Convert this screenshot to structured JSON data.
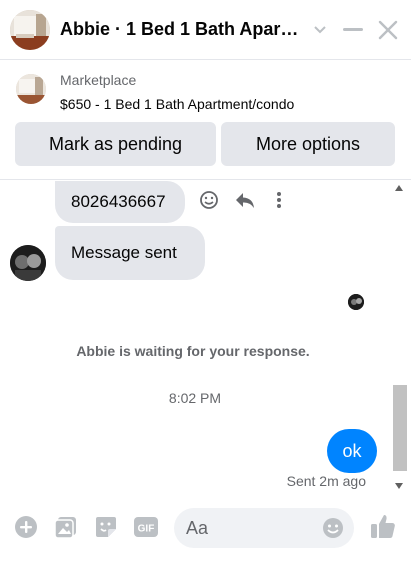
{
  "header": {
    "title": "Abbie · 1 Bed 1 Bath Apartment/condo",
    "icons": [
      "chevron-down-icon",
      "minimize-icon",
      "close-icon"
    ]
  },
  "listing": {
    "source": "Marketplace",
    "title": "$650 - 1 Bed 1 Bath Apartment/condo",
    "mark_pending_label": "Mark as pending",
    "more_options_label": "More options"
  },
  "messages": {
    "phone": "8026436667",
    "sent_text": "Message sent",
    "waiting_notice": "Abbie is waiting for your response.",
    "timestamp": "8:02 PM",
    "reply": "ok",
    "sent_status": "Sent 2m ago"
  },
  "composer": {
    "placeholder": "Aa",
    "icons": [
      "plus-icon",
      "gallery-icon",
      "sticker-icon",
      "gif-icon",
      "emoji-icon",
      "thumbs-up-icon"
    ]
  },
  "colors": {
    "accent": "#0084ff",
    "icon": "#bcc0c4",
    "bubble_in": "#e4e6eb",
    "secondary_text": "#65676b"
  }
}
